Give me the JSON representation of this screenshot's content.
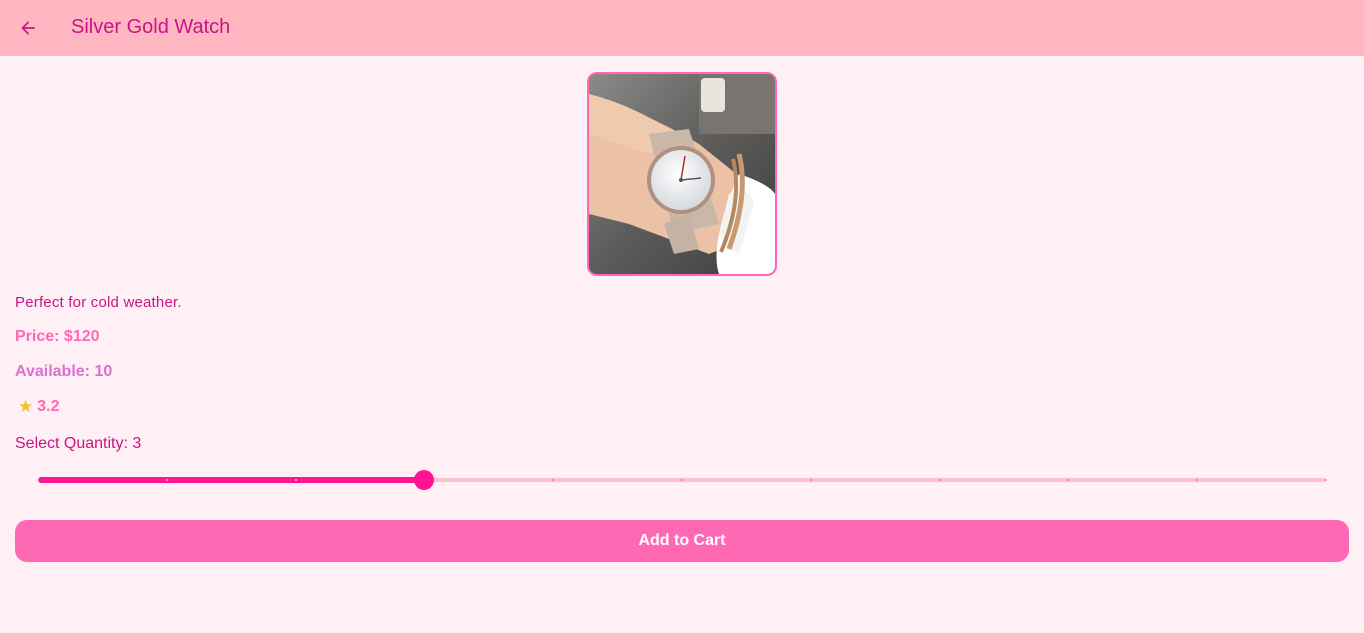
{
  "appbar": {
    "title": "Silver Gold Watch",
    "back_icon": "arrow-back-icon",
    "background": "#ffb6c1",
    "title_color": "#c71585"
  },
  "product": {
    "image_icon": "watch-photo",
    "description": "Perfect for cold weather.",
    "price_text": "Price: $120",
    "available_text": "Available: 10",
    "rating_icon": "star-icon",
    "rating_text": "3.2"
  },
  "quantity": {
    "label": "Select Quantity: 3",
    "value": 3,
    "min": 0,
    "max": 10,
    "active_color": "#ff1493",
    "inactive_color": "#ffc0cb"
  },
  "actions": {
    "add_to_cart_label": "Add to Cart",
    "button_color": "#ff69b4"
  },
  "theme": {
    "page_background": "#fff0f5"
  }
}
